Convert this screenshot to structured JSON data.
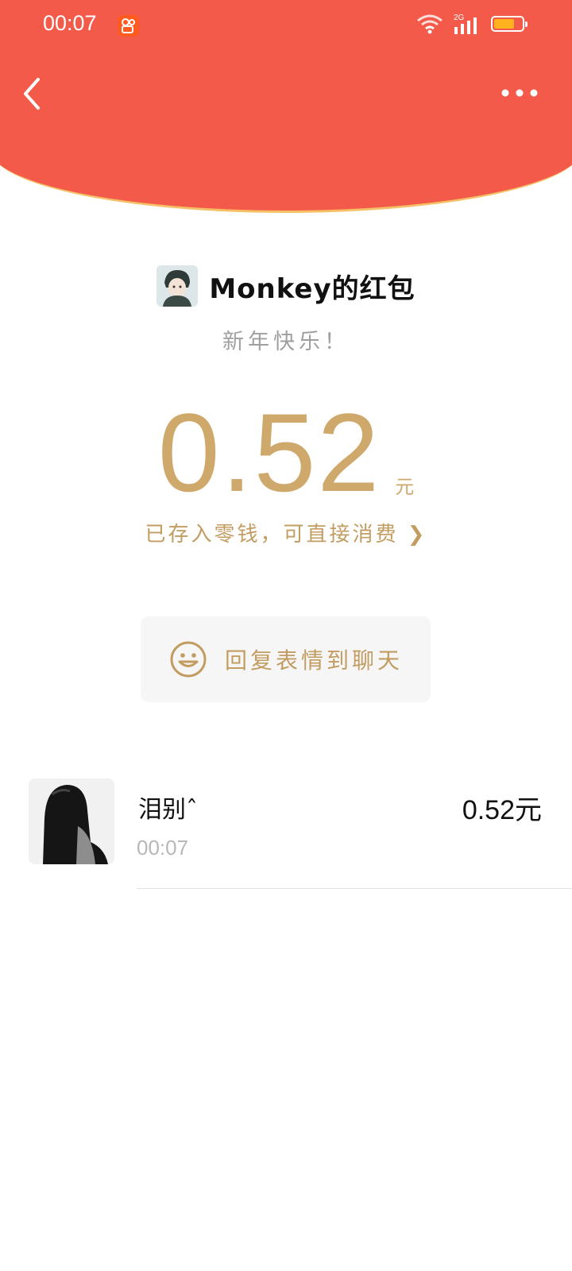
{
  "status_bar": {
    "time": "00:07",
    "network": "2G",
    "app_badge_icon": "kuaishou-app-icon",
    "wifi_icon": "wifi-icon",
    "signal_icon": "signal-icon",
    "battery_icon": "battery-icon",
    "battery_level": 0.65
  },
  "nav": {
    "back_icon": "chevron-left-icon",
    "more_icon": "more-dots-icon"
  },
  "envelope": {
    "title": "Monkey的红包",
    "greeting": "新年快乐！",
    "amount": "0.52",
    "unit": "元",
    "balance_link": "已存入零钱，可直接消费 ❯",
    "reply_label": "回复表情到聊天",
    "reply_icon": "smiley-icon"
  },
  "receivers": [
    {
      "name": "泪别ˆ",
      "time": "00:07",
      "amount": "0.52元"
    }
  ],
  "colors": {
    "header_red": "#f45a4a",
    "gold": "#cfa96b",
    "border_gold": "#f6c067"
  }
}
